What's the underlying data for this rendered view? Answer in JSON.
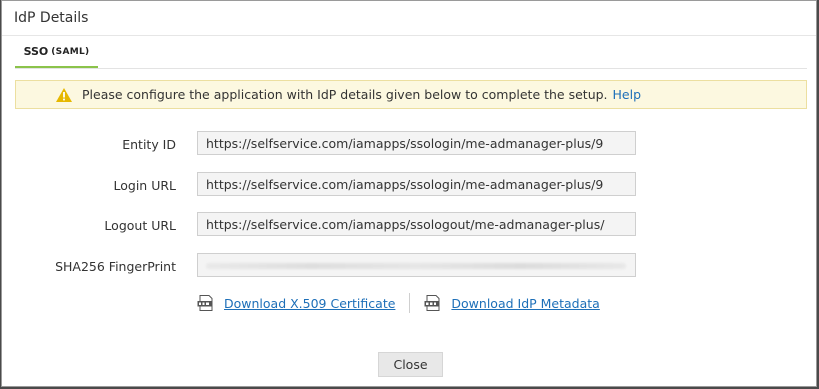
{
  "dialog": {
    "title": "IdP Details"
  },
  "tab": {
    "label": "SSO",
    "sublabel": "(SAML)"
  },
  "notice": {
    "message": "Please configure the application with IdP details given below to complete the setup.",
    "help_link": "Help"
  },
  "fields": [
    {
      "label": "Entity ID",
      "value": "https://selfservice.com/iamapps/ssologin/me-admanager-plus/9"
    },
    {
      "label": "Login URL",
      "value": "https://selfservice.com/iamapps/ssologin/me-admanager-plus/9"
    },
    {
      "label": "Logout URL",
      "value": "https://selfservice.com/iamapps/ssologout/me-admanager-plus/"
    },
    {
      "label": "SHA256 FingerPrint",
      "value": ""
    }
  ],
  "downloads": {
    "certificate": {
      "label": "Download X.509 Certificate",
      "icon": "pem-file-icon"
    },
    "metadata": {
      "label": "Download IdP Metadata",
      "icon": "xml-file-icon"
    }
  },
  "buttons": {
    "close": "Close"
  },
  "colors": {
    "accent_tab": "#8bc34a",
    "link": "#1d6fb8",
    "notice_bg": "#fcf8e0",
    "warning": "#e6b800"
  }
}
